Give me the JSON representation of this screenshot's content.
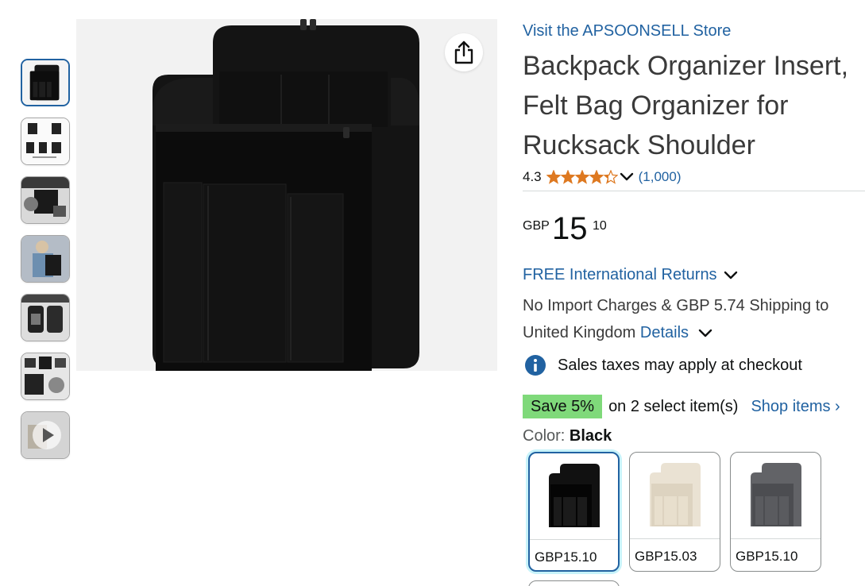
{
  "store": {
    "link_text": "Visit the APSOONSELL Store"
  },
  "product": {
    "title": "Backpack Organizer Insert, Felt Bag Organizer for Rucksack Shoulder",
    "rating": "4.3",
    "rating_count": "(1,000)",
    "stars_value": 4.3
  },
  "price": {
    "currency": "GBP",
    "whole": "15",
    "fraction": "10"
  },
  "delivery": {
    "returns_text": "FREE International Returns",
    "shipping_text": "No Import Charges & GBP 5.74 Shipping to United Kingdom",
    "details_link": "Details"
  },
  "tax": {
    "text": "Sales taxes may apply at checkout"
  },
  "promo": {
    "badge": "Save 5%",
    "text": "on 2 select item(s)",
    "link": "Shop items ›"
  },
  "color": {
    "label": "Color:",
    "selected": "Black",
    "options": [
      {
        "name": "Black",
        "price": "GBP15.10",
        "color": "#111111"
      },
      {
        "name": "Beige",
        "price": "GBP15.03",
        "color": "#e9e1d1"
      },
      {
        "name": "Grey",
        "price": "GBP15.10",
        "color": "#5a5b5e"
      }
    ]
  },
  "thumbnails": [
    {
      "name": "main-black"
    },
    {
      "name": "dimensions"
    },
    {
      "name": "features"
    },
    {
      "name": "lifestyle"
    },
    {
      "name": "in-use"
    },
    {
      "name": "details"
    },
    {
      "name": "video"
    }
  ],
  "icons": {
    "share": "share-icon",
    "info": "info-icon",
    "chevron": "chevron-down-icon",
    "play": "play-icon"
  },
  "colors": {
    "link": "#2162a1",
    "star": "#de7921",
    "save_badge": "#7fd97a",
    "selected_border": "#2162a1"
  }
}
